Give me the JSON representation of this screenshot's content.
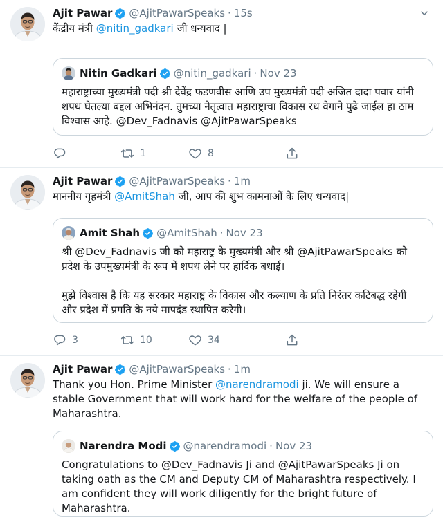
{
  "tweets": [
    {
      "name": "Ajit Pawar",
      "handle": "@AjitPawarSpeaks",
      "time": "15s",
      "text_before": "केंद्रीय मंत्री ",
      "mention": "@nitin_gadkari",
      "text_after": " जी धन्यवाद |",
      "quote": {
        "name": "Nitin Gadkari",
        "handle": "@nitin_gadkari",
        "date": "Nov 23",
        "paragraphs": [
          "महाराष्ट्राच्या मुख्यमंत्री पदी श्री देवेंद्र फडणवीस आणि उप मुख्यमंत्री पदी अजित दादा पवार यांनी शपथ घेतल्या बद्दल अभिनंदन. तुमच्या नेतृत्वात महाराष्ट्राचा विकास रथ वेगाने पुढे जाईल हा ठाम विश्वास आहे. @Dev_Fadnavis @AjitPawarSpeaks"
        ]
      },
      "replies": "",
      "retweets": "1",
      "likes": "8"
    },
    {
      "name": "Ajit Pawar",
      "handle": "@AjitPawarSpeaks",
      "time": "1m",
      "text_before": "माननीय गृहमंत्री ",
      "mention": "@AmitShah",
      "text_after": " जी, आप की शुभ कामनाओं के लिए धन्यवाद|",
      "quote": {
        "name": "Amit Shah",
        "handle": "@AmitShah",
        "date": "Nov 23",
        "paragraphs": [
          "श्री @Dev_Fadnavis जी को महाराष्ट्र के मुख्यमंत्री और श्री @AjitPawarSpeaks को प्रदेश के उपमुख्यमंत्री के रूप में शपथ लेने पर हार्दिक बधाई।",
          "मुझे विश्वास है कि यह सरकार महाराष्ट्र के विकास और कल्याण के प्रति निरंतर कटिबद्ध रहेगी और प्रदेश में प्रगति के नये मापदंड स्थापित करेगी।"
        ]
      },
      "replies": "3",
      "retweets": "10",
      "likes": "34"
    },
    {
      "name": "Ajit Pawar",
      "handle": "@AjitPawarSpeaks",
      "time": "1m",
      "text_before": "Thank you Hon. Prime Minister ",
      "mention": "@narendramodi",
      "text_after": " ji. We will ensure a stable Government that will work hard for the welfare of the people of Maharashtra.",
      "quote": {
        "name": "Narendra Modi",
        "handle": "@narendramodi",
        "date": "Nov 23",
        "paragraphs": [
          "Congratulations to @Dev_Fadnavis Ji and @AjitPawarSpeaks Ji on taking oath as the CM and Deputy CM of Maharashtra respectively. I am confident they will work diligently for the bright future of Maharashtra."
        ]
      }
    }
  ],
  "colors": {
    "accent": "#1b95e0",
    "secondary_text": "#657786",
    "border": "#e6ecf0",
    "verified": "#1da1f2"
  },
  "icons": {
    "verified": "verified-badge-icon",
    "caret": "chevron-down-icon",
    "reply": "reply-icon",
    "retweet": "retweet-icon",
    "like": "heart-icon",
    "share": "share-icon"
  }
}
